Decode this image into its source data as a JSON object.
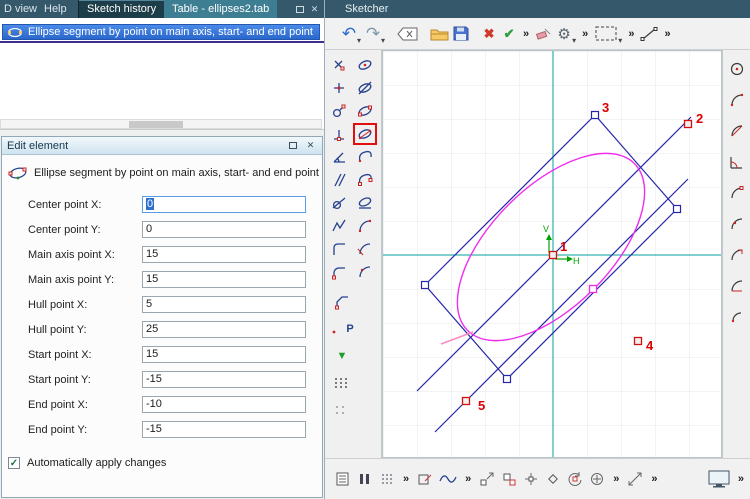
{
  "left": {
    "tabs": {
      "dview": "D view",
      "help": "Help",
      "sketch_history": "Sketch history",
      "table": "Table - ellipses2.tab"
    },
    "history": {
      "selected": "Ellipse segment by point on main axis, start- and end point"
    },
    "edit": {
      "title": "Edit element",
      "description": "Ellipse segment by point on main axis, start- and end point",
      "fields": [
        {
          "label": "Center point X:",
          "value": "0"
        },
        {
          "label": "Center point Y:",
          "value": "0"
        },
        {
          "label": "Main axis point X:",
          "value": "15"
        },
        {
          "label": "Main axis point Y:",
          "value": "15"
        },
        {
          "label": "Hull point X:",
          "value": "5"
        },
        {
          "label": "Hull point Y:",
          "value": "25"
        },
        {
          "label": "Start point X:",
          "value": "15"
        },
        {
          "label": "Start point Y:",
          "value": "-15"
        },
        {
          "label": "End point X:",
          "value": "-10"
        },
        {
          "label": "End point Y:",
          "value": "-15"
        }
      ],
      "auto_apply": "Automatically apply changes"
    }
  },
  "right": {
    "title": "Sketcher"
  },
  "icons": {
    "undo": "↶",
    "redo": "↷",
    "caret": "▾",
    "more": "»",
    "cancel": "✖",
    "confirm": "✔",
    "gear": "⚙",
    "close": "✕",
    "triangle": "▼",
    "check": "✓",
    "point_label": "P"
  },
  "canvas": {
    "points": {
      "p1": "1",
      "p2": "2",
      "p3": "3",
      "p4": "4",
      "p5": "5"
    },
    "axes": {
      "v": "V",
      "h": "H"
    }
  }
}
